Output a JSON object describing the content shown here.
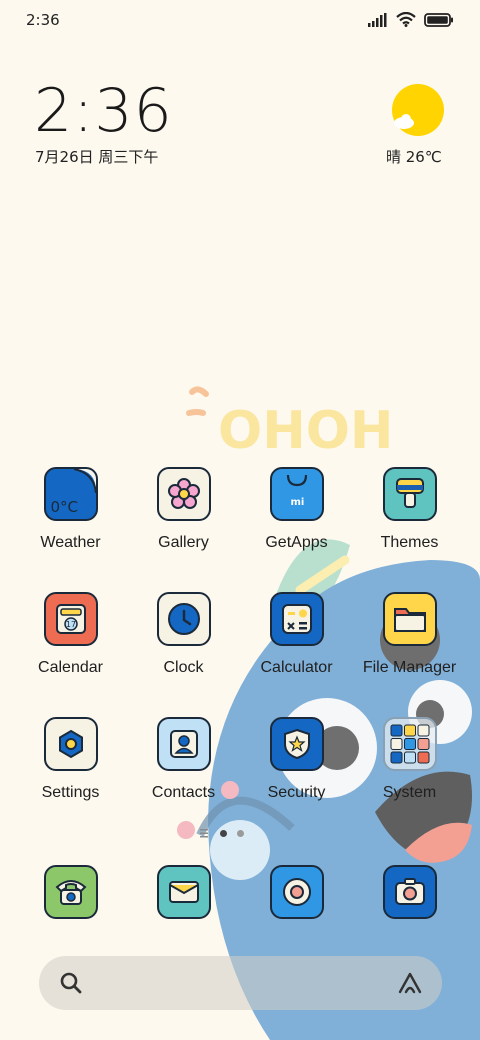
{
  "status_bar": {
    "time": "2:36"
  },
  "clock_widget": {
    "time": "2:36",
    "date": "7月26日 周三下午"
  },
  "weather_widget": {
    "summary": "晴 26℃"
  },
  "wallpaper": {
    "graffiti_text": "OHOH"
  },
  "apps": [
    {
      "label": "Weather",
      "icon": "weather-icon",
      "icon_text": "0°C"
    },
    {
      "label": "Gallery",
      "icon": "flower-icon"
    },
    {
      "label": "GetApps",
      "icon": "shopping-bag-icon",
      "icon_text": "mi"
    },
    {
      "label": "Themes",
      "icon": "paint-roller-icon"
    },
    {
      "label": "Calendar",
      "icon": "calendar-icon",
      "icon_text": "17"
    },
    {
      "label": "Clock",
      "icon": "clock-icon"
    },
    {
      "label": "Calculator",
      "icon": "calculator-icon"
    },
    {
      "label": "File Manager",
      "icon": "folder-icon"
    },
    {
      "label": "Settings",
      "icon": "gear-icon"
    },
    {
      "label": "Contacts",
      "icon": "contact-card-icon"
    },
    {
      "label": "Security",
      "icon": "shield-icon"
    },
    {
      "label": "System",
      "icon": "folder-grid-icon"
    }
  ],
  "dock": [
    {
      "icon": "phone-icon"
    },
    {
      "icon": "message-icon"
    },
    {
      "icon": "browser-icon"
    },
    {
      "icon": "camera-icon"
    }
  ],
  "search_bar": {
    "left_icon": "search-icon",
    "right_icon": "assistant-icon"
  },
  "colors": {
    "background": "#fdf9ef",
    "wallpaper_monster": "#80b0d8",
    "accent_blue": "#1565b8",
    "sun": "#ffd400"
  }
}
